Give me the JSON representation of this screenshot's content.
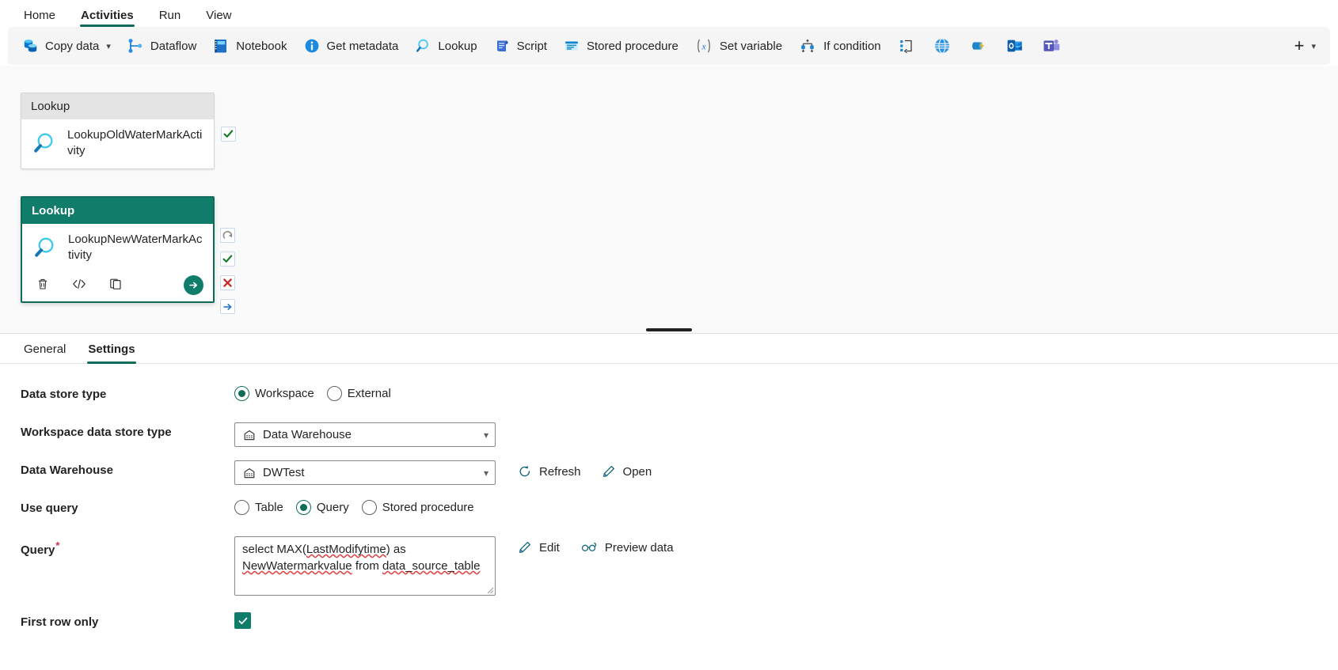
{
  "ribbon": {
    "tabs": [
      {
        "label": "Home",
        "active": false
      },
      {
        "label": "Activities",
        "active": true
      },
      {
        "label": "Run",
        "active": false
      },
      {
        "label": "View",
        "active": false
      }
    ],
    "accent": "#0f6c5b"
  },
  "commandbar": {
    "items": [
      {
        "label": "Copy data",
        "icon": "copy-data-icon",
        "caret": true
      },
      {
        "label": "Dataflow",
        "icon": "dataflow-icon",
        "caret": false
      },
      {
        "label": "Notebook",
        "icon": "notebook-icon",
        "caret": false
      },
      {
        "label": "Get metadata",
        "icon": "get-metadata-icon",
        "caret": false
      },
      {
        "label": "Lookup",
        "icon": "lookup-icon",
        "caret": false
      },
      {
        "label": "Script",
        "icon": "script-icon",
        "caret": false
      },
      {
        "label": "Stored procedure",
        "icon": "stored-procedure-icon",
        "caret": false
      },
      {
        "label": "Set variable",
        "icon": "set-variable-icon",
        "caret": false
      },
      {
        "label": "If condition",
        "icon": "if-condition-icon",
        "caret": false
      }
    ],
    "icon_only": [
      {
        "icon": "switch-case-icon"
      },
      {
        "icon": "web-globe-icon"
      },
      {
        "icon": "azure-function-icon"
      },
      {
        "icon": "outlook-icon"
      },
      {
        "icon": "teams-icon"
      }
    ],
    "add": {
      "plus": "+",
      "caret": "˅"
    }
  },
  "canvas": {
    "activities": [
      {
        "type": "Lookup",
        "name": "LookupOldWaterMarkActivity",
        "selected": false,
        "icon": "lookup-magnifier-icon",
        "handles": [
          {
            "name": "success-handle",
            "glyph": "check"
          }
        ]
      },
      {
        "type": "Lookup",
        "name": "LookupNewWaterMarkActivity",
        "selected": true,
        "icon": "lookup-magnifier-icon",
        "handles": [
          {
            "name": "skip-handle",
            "glyph": "arc"
          },
          {
            "name": "success-handle",
            "glyph": "check"
          },
          {
            "name": "failure-handle",
            "glyph": "cross"
          },
          {
            "name": "completion-handle",
            "glyph": "arrow"
          }
        ],
        "toolbar": [
          {
            "name": "delete-activity-button",
            "icon": "trash-icon"
          },
          {
            "name": "view-code-button",
            "icon": "code-icon"
          },
          {
            "name": "duplicate-activity-button",
            "icon": "copy-icon"
          }
        ],
        "run_button": {
          "name": "run-activity-button",
          "icon": "arrow-right-icon"
        }
      }
    ]
  },
  "properties": {
    "tabs": [
      {
        "label": "General",
        "active": false
      },
      {
        "label": "Settings",
        "active": true
      }
    ],
    "fields": {
      "data_store_type": {
        "label": "Data store type",
        "options": [
          {
            "label": "Workspace",
            "checked": true
          },
          {
            "label": "External",
            "checked": false
          }
        ]
      },
      "workspace_data_store_type": {
        "label": "Workspace data store type",
        "value": "Data Warehouse",
        "icon": "warehouse-icon"
      },
      "data_warehouse": {
        "label": "Data Warehouse",
        "value": "DWTest",
        "icon": "warehouse-icon",
        "actions": [
          {
            "label": "Refresh",
            "icon": "refresh-icon"
          },
          {
            "label": "Open",
            "icon": "pencil-icon"
          }
        ]
      },
      "use_query": {
        "label": "Use query",
        "options": [
          {
            "label": "Table",
            "checked": false
          },
          {
            "label": "Query",
            "checked": true
          },
          {
            "label": "Stored procedure",
            "checked": false
          }
        ]
      },
      "query": {
        "label": "Query",
        "required": "*",
        "value_parts": [
          {
            "text": "select MAX(",
            "spell": false
          },
          {
            "text": "LastModifytime",
            "spell": true
          },
          {
            "text": ") as ",
            "spell": false
          },
          {
            "text": "NewWatermarkvalue",
            "spell": true
          },
          {
            "text": " from ",
            "spell": false
          },
          {
            "text": "data_source_table",
            "spell": true
          }
        ],
        "value": "select MAX(LastModifytime) as NewWatermarkvalue from data_source_table",
        "actions": [
          {
            "label": "Edit",
            "icon": "pencil-icon"
          },
          {
            "label": "Preview data",
            "icon": "glasses-icon"
          }
        ]
      },
      "first_row_only": {
        "label": "First row only",
        "checked": true,
        "check_glyph": "✓"
      }
    }
  },
  "colors": {
    "accent_teal": "#0f6c5b",
    "header_teal": "#107c6a",
    "required_red": "#c4314b",
    "spellcheck_red": "#e03e3e",
    "canvas_bg": "#fafafa",
    "cmdbar_bg": "#f5f5f5"
  }
}
